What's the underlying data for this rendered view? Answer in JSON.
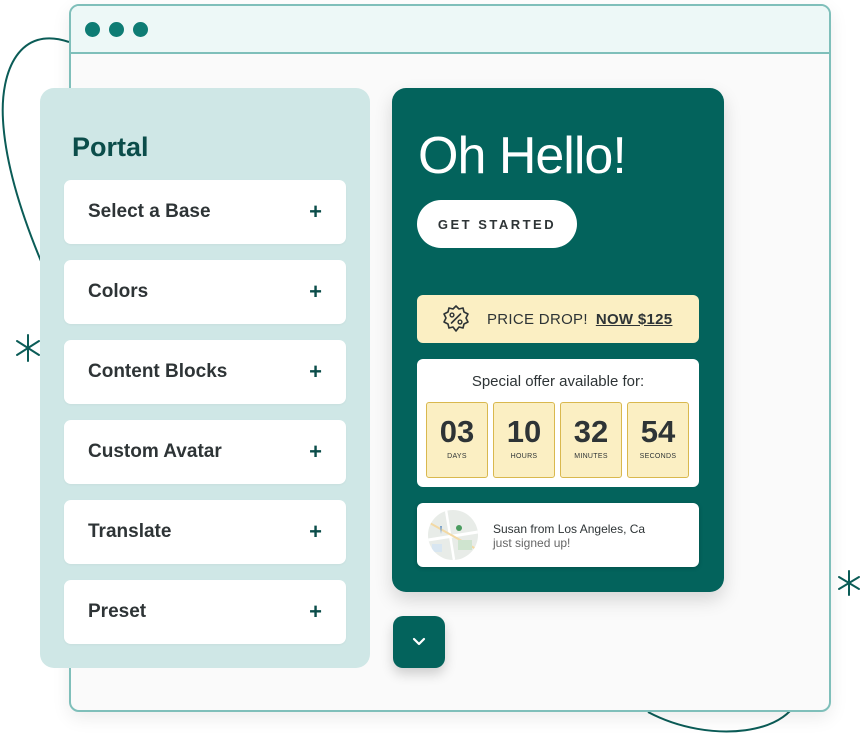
{
  "window": {
    "controls": [
      "close",
      "minimize",
      "maximize"
    ]
  },
  "portal": {
    "title": "Portal",
    "items": [
      {
        "label": "Select a Base"
      },
      {
        "label": "Colors"
      },
      {
        "label": "Content Blocks"
      },
      {
        "label": "Custom Avatar"
      },
      {
        "label": "Translate"
      },
      {
        "label": "Preset"
      }
    ],
    "item_icon": "plus-icon"
  },
  "hero": {
    "title": "Oh Hello!",
    "cta_label": "GET STARTED",
    "price_drop": {
      "icon": "percent-badge-icon",
      "text": "PRICE DROP!",
      "link": "NOW $125"
    },
    "offer": {
      "title": "Special offer available for:",
      "countdown": [
        {
          "value": "03",
          "unit": "DAYS"
        },
        {
          "value": "10",
          "unit": "HOURS"
        },
        {
          "value": "32",
          "unit": "MINUTES"
        },
        {
          "value": "54",
          "unit": "SECONDS"
        }
      ]
    },
    "notification": {
      "name": "Susan from Los Angeles, Ca",
      "message": "just signed up!",
      "thumbnail": "map-icon"
    }
  },
  "scroll_button": {
    "icon": "chevron-down-icon"
  },
  "colors": {
    "brand": "#03635c",
    "panel": "#cfe7e6",
    "highlight": "#fbefc3",
    "accent_border": "#7fbfba"
  }
}
